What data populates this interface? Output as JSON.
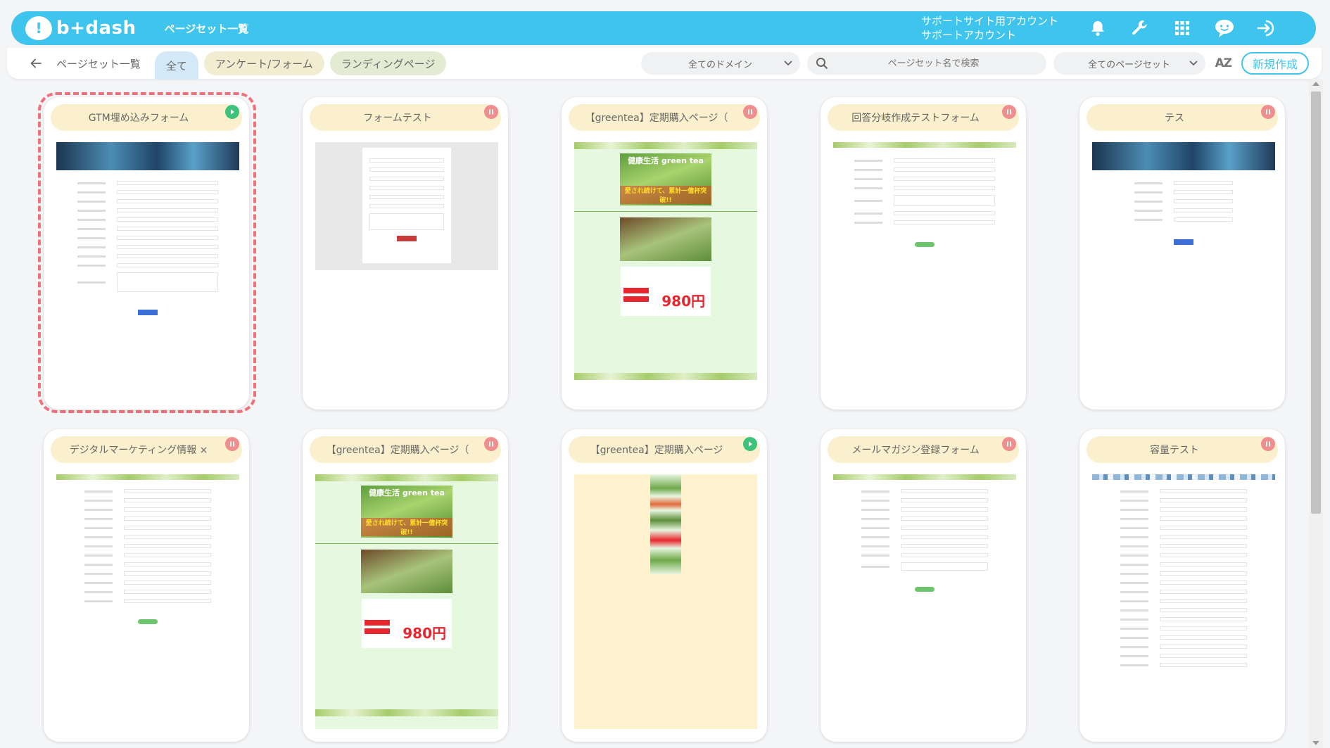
{
  "app": {
    "logo_mark": "!",
    "logo_text": "b+dash",
    "page_title": "ページセット一覧",
    "account_line1": "サポートサイト用アカウント",
    "account_line2": "サポートアカウント"
  },
  "toolbar": {
    "breadcrumb": "ページセット一覧",
    "tabs": [
      "全て",
      "アンケート/フォーム",
      "ランディングページ"
    ],
    "domain_select": "全てのドメイン",
    "search_placeholder": "ページセット名で検索",
    "pageset_select": "全てのページセット",
    "sort_label": "AZ",
    "new_button": "新規作成"
  },
  "cards": [
    {
      "title": "GTM埋め込みフォーム",
      "status": "play"
    },
    {
      "title": "フォームテスト",
      "status": "pause"
    },
    {
      "title": "【greentea】定期購入ページ（",
      "status": "pause"
    },
    {
      "title": "回答分岐作成テストフォーム",
      "status": "pause"
    },
    {
      "title": "テス",
      "status": "pause"
    },
    {
      "title": "デジタルマーケティング情報 ×",
      "status": "pause"
    },
    {
      "title": "【greentea】定期購入ページ（",
      "status": "pause"
    },
    {
      "title": "【greentea】定期購入ページ",
      "status": "play"
    },
    {
      "title": "メールマガジン登録フォーム",
      "status": "pause"
    },
    {
      "title": "容量テスト",
      "status": "pause"
    }
  ],
  "thumb_text": {
    "greentea_title": "健康生活 green tea",
    "greentea_sub": "愛され続けて、累計一億杯突破!!",
    "greentea_price": "980円"
  },
  "colors": {
    "accent": "#3fc4ee",
    "pause": "#f08e8e",
    "play": "#3cc47c",
    "selection": "#f0707c"
  }
}
